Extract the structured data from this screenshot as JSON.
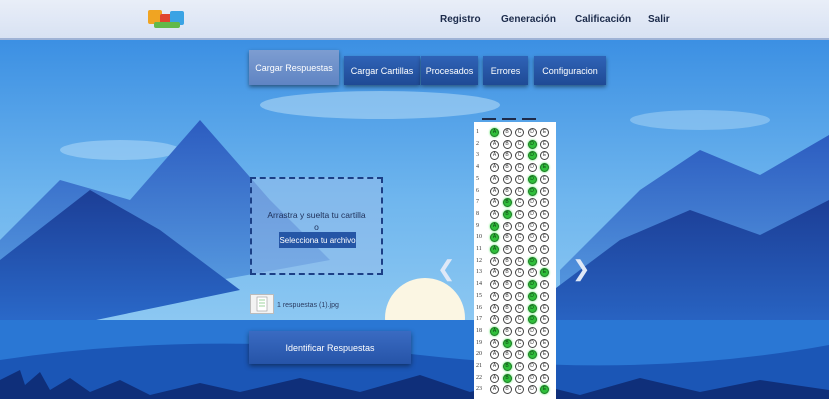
{
  "nav": {
    "logo_alt": "logo",
    "items": [
      "Registro",
      "Generación",
      "Calificación",
      "Salir"
    ]
  },
  "tabs": [
    {
      "label": "Cargar Respuestas",
      "active": true
    },
    {
      "label": "Cargar Cartillas",
      "active": false
    },
    {
      "label": "Procesados",
      "active": false
    },
    {
      "label": "Errores",
      "active": false
    },
    {
      "label": "Configuracion",
      "active": false
    }
  ],
  "upload": {
    "drop_text": "Arrastra y suelta tu cartilla",
    "or_text": "o",
    "select_label": "Selecciona tu archivo"
  },
  "file": {
    "label": "1 respuestas (1).jpg"
  },
  "identify_label": "Identificar Respuestas",
  "sheet": {
    "options": [
      "A",
      "B",
      "C",
      "D",
      "E"
    ],
    "answers": [
      {
        "n": 1,
        "filled": 0
      },
      {
        "n": 2,
        "filled": 3
      },
      {
        "n": 3,
        "filled": 3
      },
      {
        "n": 4,
        "filled": 4
      },
      {
        "n": 5,
        "filled": 3
      },
      {
        "n": 6,
        "filled": 3
      },
      {
        "n": 7,
        "filled": 1
      },
      {
        "n": 8,
        "filled": 1
      },
      {
        "n": 9,
        "filled": 0
      },
      {
        "n": 10,
        "filled": 0
      },
      {
        "n": 11,
        "filled": 0
      },
      {
        "n": 12,
        "filled": 3
      },
      {
        "n": 13,
        "filled": 4
      },
      {
        "n": 14,
        "filled": 3
      },
      {
        "n": 15,
        "filled": 3
      },
      {
        "n": 16,
        "filled": 3
      },
      {
        "n": 17,
        "filled": 3
      },
      {
        "n": 18,
        "filled": 0
      },
      {
        "n": 19,
        "filled": 1
      },
      {
        "n": 20,
        "filled": 3
      },
      {
        "n": 21,
        "filled": 1
      },
      {
        "n": 22,
        "filled": 1
      },
      {
        "n": 23,
        "filled": 4
      }
    ]
  },
  "colors": {
    "sky": "#3a8fe0",
    "mountain_dark": "#1a3f9a",
    "button": "#2654a8",
    "bubble_fill": "#2fbf3a"
  },
  "icons": {
    "prev": "chevron-left-icon",
    "next": "chevron-right-icon"
  }
}
